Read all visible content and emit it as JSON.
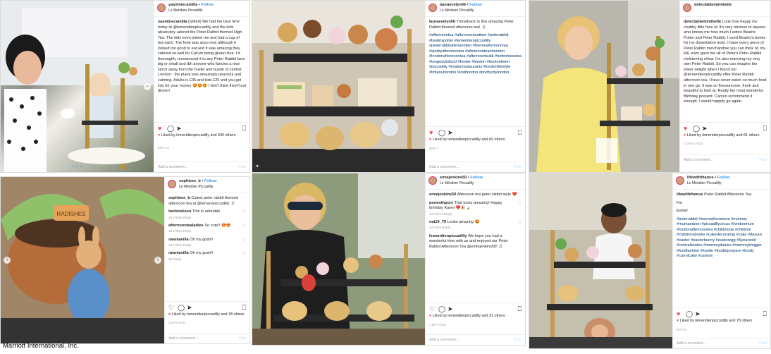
{
  "footer": "Marriott International, Inc.",
  "ui": {
    "follow_label": "Follow",
    "dot_separator": "•",
    "add_comment": "Add a comment...",
    "post_label": "Post",
    "more": "•••",
    "reply": "Reply"
  },
  "posts": [
    {
      "username": "yasminecamilla",
      "location": "Le Méridien Piccadilly",
      "caption_user": "yasminecamilla",
      "caption": "(Gifted) We had the best time today at @lemeridienpiccadilly and the kids absolutely adored the Peter Rabbit themed High Tea. The kids even joined me and had a cup of tea each. The food was sooo nice although it looked too good to eat and it was amazing they catered so well for Cal'um being gluten-free. I'd thoroughly recommend it to any Peter Rabbit fans big or small and tbh anyone who fancies a nice lunch away from the hustle and bustle of central London - the place was amazingly peaceful and calming. Adults is £35 and kids £25 and you get lots for your money 😍😍😍 I don't think they'll eat dinner!",
      "liked_by": "Liked by lemeridienpiccadilly and 500 others",
      "date": "MAY 12"
    },
    {
      "username": "lauraevelyn06",
      "location": "Le Méridien Piccadilly",
      "caption_user": "lauraevelyn06",
      "caption": "Throwback to this amazing Peter Rabbit themed afternoon tea! 🐰",
      "hashtags": "#afternoontea #afternoonteatime #peterrabbit #beatrixpotter #lemeridienpiccadilly #peterrabbitatlemeridien #themeafternoontea #quirkyafternoontea #afternoonteaintondon #londonafternoontea #afternoontealk #bottomlesstea #toogoodtofood #foodie #london #londonhotel #piccadilly #londonrestaurants #londonlifestyle #timeoutlondon #visitlondon #prettycitylondon",
      "liked_by": "Liked by lemeridienpiccadilly and 69 others",
      "date": "MAY 7"
    },
    {
      "username": "delectablemimibelle",
      "location": "",
      "caption_user": "delectablemimibelle",
      "caption": "Look how happy my chubby little face is! It's very obvious to anyone who knows me how much I adore Beatrix Potter and Peter Rabbit. I used Beatrix's books for my dissertation texts. I have every piece of Peter Rabbit merchandise you can think of, my Mil, even gave me all of Peter's Peter Rabbit christening china. I'm also marrying my very own Peter Rabbit. So you can imagine the sheer delight when I found out @lemeridienpiccadilly offer Peter Rabbit afternoon tea. I have never eaten so much food in one go. It was so flavoursome, fresh and beautiful to look at. Really the most wonderful Birthday present. Cannot recommend it enough. I would happily go again.",
      "liked_by": "Liked by lemeridienpiccadilly and 81 others",
      "date": "2 DAYS AGO"
    },
    {
      "username": "sophieee_b",
      "location": "Le Méridien Piccadilly",
      "caption_user": "sophieee_b",
      "caption": "Cutest peter rabbit themed afternoon tea at @terracepiccadilly 🐰",
      "comments": [
        {
          "user": "beckinolsen",
          "text": "This is adorable",
          "meta": "1d   2 likes   Reply"
        },
        {
          "user": "afternoontealadies",
          "text": "So cute!! 😍😍",
          "meta": "1d   2 likes   Reply"
        },
        {
          "user": "rawniavilla",
          "text": "Oh my gosh!!",
          "meta": "1d   2 likes   Reply"
        },
        {
          "user": "rawniavilla",
          "text": "Oh my gosh!!",
          "meta": "1d   Reply"
        }
      ],
      "liked_by": "Liked by lemeridienpiccadilly and 38 others",
      "date": "1 DAY AGO"
    },
    {
      "username": "emiejenkins50",
      "location": "Le Méridien Piccadilly",
      "caption_user": "emiejenkins50",
      "caption": "Afternoon tea peter rabbit style ❤️",
      "comments": [
        {
          "user": "pooenthpure",
          "text": "That looks amazing! Happy birthday Karen ❤️🎉🍃",
          "meta": "1d   2 likes   Reply"
        },
        {
          "user": "nat19_79",
          "text": "Looks amazing 😍",
          "meta": "1d   1 like   Reply"
        },
        {
          "user": "lemeridienpiccadilly",
          "text": "We hope you had a wonderful time with us and enjoyed our Peter Rabbit Afternoon Tea @emiejenkins50! 🐰",
          "meta": ""
        }
      ],
      "liked_by": "Liked by lemeridienpiccadilly and 31 others",
      "date": "1 DAY AGO"
    },
    {
      "username": "lifewiththanus",
      "location": "Le Méridien Piccadilly",
      "caption_user": "lifewiththanus",
      "caption": "Peter Rabbit Afternoon Tea",
      "lines": [
        "For",
        "Easter"
      ],
      "hashtags": "#peterrabbit #mumwithcamera #mummy #mumandson #piccadillycircus #londonmum #londonafternoontea #childmode #children #childrensbooks #cakedecorating #cake #dayout #easter #easterbunny #easteregg #5yearsold #centrallondon #mummydiaries #mummyblogger #foodfashion #foodie #foodtoprepare #foody #carrotcake #carrots",
      "liked_by": "Liked by lemeridienpiccadilly and 78 others",
      "date": "MAY 8"
    }
  ]
}
